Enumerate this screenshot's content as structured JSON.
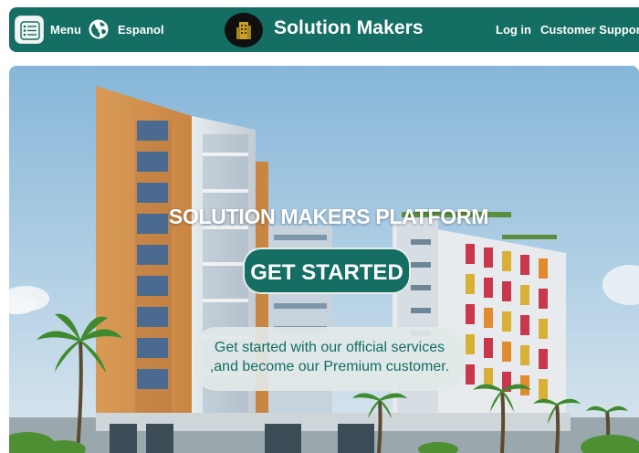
{
  "header": {
    "menu_label": "Menu",
    "language_label": "Espanol",
    "brand_title": "Solution Makers",
    "login_label": "Log in",
    "support_label": "Customer Support"
  },
  "hero": {
    "heading": "SOLUTION MAKERS PLATFORM",
    "cta_label": "GET STARTED",
    "promo_line1": "Get started with our official services",
    "promo_line2": ",and become our Premium customer."
  },
  "icons": {
    "menu": "menu-list-icon",
    "language": "globe-icon",
    "logo": "building-logo-icon"
  },
  "colors": {
    "brand": "#146e63",
    "header_text": "#ffffff",
    "promo_bg": "#e2e8e8",
    "promo_text": "#146e63"
  }
}
